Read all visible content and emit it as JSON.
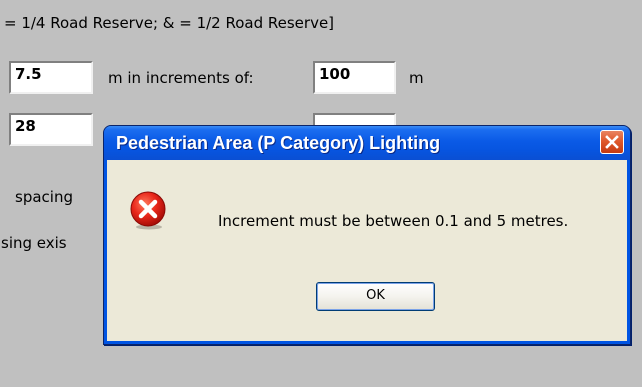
{
  "background": {
    "legend_text": "= 1/4 Road Reserve; & = 1/2 Road Reserve]",
    "row1": {
      "value": "7.5",
      "label": "m in increments of:",
      "increment_value": "100",
      "unit": "m"
    },
    "row2": {
      "value": "28"
    },
    "spacing_text": "spacing",
    "existing_text": "sing exis"
  },
  "dialog": {
    "title": "Pedestrian Area (P Category) Lighting",
    "message": "Increment must be between 0.1 and 5 metres.",
    "ok_label": "OK",
    "icon": "error-icon",
    "colors": {
      "titlebar": "#0a5ae6",
      "close": "#e0592c",
      "client": "#ece9d8"
    }
  }
}
